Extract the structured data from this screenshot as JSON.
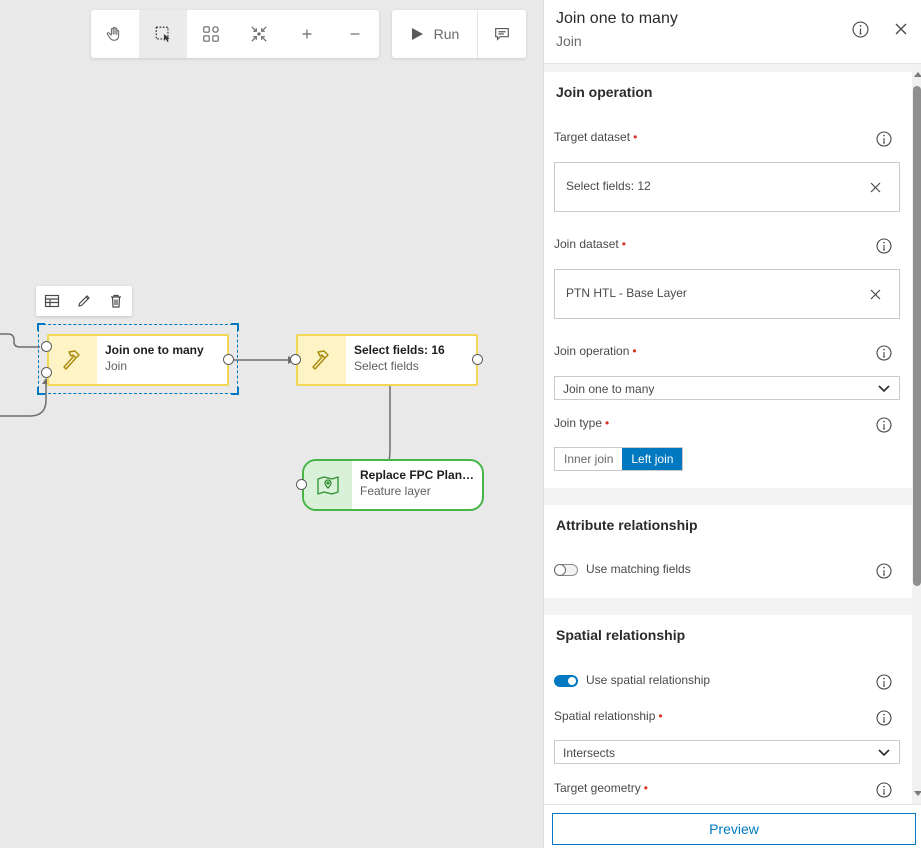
{
  "toolbar": {
    "tools": [
      {
        "name": "pan-icon"
      },
      {
        "name": "select-icon",
        "active": true
      },
      {
        "name": "auto-layout-icon"
      },
      {
        "name": "fit-icon"
      },
      {
        "name": "zoom-in-icon"
      },
      {
        "name": "zoom-out-icon"
      }
    ],
    "run_label": "Run"
  },
  "nodes": {
    "join": {
      "title": "Join one to many",
      "subtitle": "Join"
    },
    "select": {
      "title": "Select fields: 16",
      "subtitle": "Select fields"
    },
    "layer": {
      "title": "Replace FPC Plant...",
      "subtitle": "Feature layer"
    }
  },
  "colors": {
    "accent": "#0079c1",
    "tool_border": "#f3d656",
    "tool_fill": "#fdf3c5",
    "layer_border": "#47b548",
    "layer_fill": "#d9f1d8",
    "required": "#d83020"
  },
  "panel": {
    "title": "Join one to many",
    "subtitle": "Join",
    "join_section": {
      "title": "Join operation",
      "target_label": "Target dataset",
      "target_value": "Select fields: 12",
      "join_label": "Join dataset",
      "join_value": "PTN HTL - Base Layer",
      "operation_label": "Join operation",
      "operation_value": "Join one to many",
      "type_label": "Join type",
      "type_options": [
        "Inner join",
        "Left join"
      ],
      "type_selected": "Left join"
    },
    "attribute_section": {
      "title": "Attribute relationship",
      "toggle_label": "Use matching fields",
      "toggle_on": false
    },
    "spatial_section": {
      "title": "Spatial relationship",
      "toggle_label": "Use spatial relationship",
      "toggle_on": true,
      "relationship_label": "Spatial relationship",
      "relationship_value": "Intersects",
      "geometry_label": "Target geometry"
    },
    "preview_label": "Preview"
  }
}
